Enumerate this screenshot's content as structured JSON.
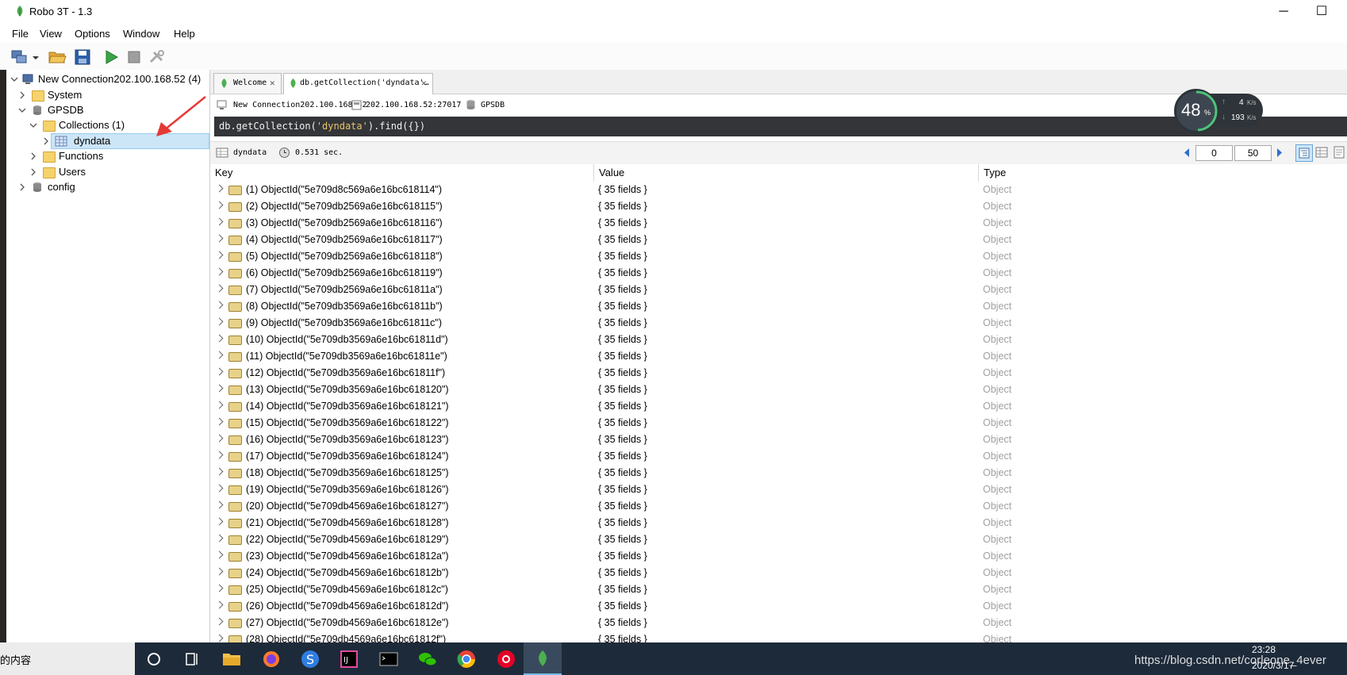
{
  "window": {
    "title": "Robo 3T - 1.3",
    "minimize": "─",
    "maximize": "☐"
  },
  "menu": [
    "File",
    "View",
    "Options",
    "Window",
    "Help"
  ],
  "tree": {
    "connection": "New Connection202.100.168.52 (4)",
    "system": "System",
    "db": "GPSDB",
    "collections": "Collections (1)",
    "collection_item": "dyndata",
    "functions": "Functions",
    "users": "Users",
    "config": "config"
  },
  "tabs": [
    {
      "label": "Welcome"
    },
    {
      "label": "db.getCollection('dyndata'…"
    }
  ],
  "info": {
    "connection": "New Connection202.100.168.52",
    "host": "202.100.168.52:27017",
    "db": "GPSDB"
  },
  "query": {
    "prefix": "db.getCollection(",
    "arg": "'dyndata'",
    "suffix": ").find({})"
  },
  "results": {
    "collection": "dyndata",
    "time": "0.531 sec.",
    "skip": "0",
    "limit": "50"
  },
  "table": {
    "headers": [
      "Key",
      "Value",
      "Type"
    ],
    "value": "{ 35 fields }",
    "type": "Object",
    "keys": [
      "(1) ObjectId(\"5e709d8c569a6e16bc618114\")",
      "(2) ObjectId(\"5e709db2569a6e16bc618115\")",
      "(3) ObjectId(\"5e709db2569a6e16bc618116\")",
      "(4) ObjectId(\"5e709db2569a6e16bc618117\")",
      "(5) ObjectId(\"5e709db2569a6e16bc618118\")",
      "(6) ObjectId(\"5e709db2569a6e16bc618119\")",
      "(7) ObjectId(\"5e709db2569a6e16bc61811a\")",
      "(8) ObjectId(\"5e709db3569a6e16bc61811b\")",
      "(9) ObjectId(\"5e709db3569a6e16bc61811c\")",
      "(10) ObjectId(\"5e709db3569a6e16bc61811d\")",
      "(11) ObjectId(\"5e709db3569a6e16bc61811e\")",
      "(12) ObjectId(\"5e709db3569a6e16bc61811f\")",
      "(13) ObjectId(\"5e709db3569a6e16bc618120\")",
      "(14) ObjectId(\"5e709db3569a6e16bc618121\")",
      "(15) ObjectId(\"5e709db3569a6e16bc618122\")",
      "(16) ObjectId(\"5e709db3569a6e16bc618123\")",
      "(17) ObjectId(\"5e709db3569a6e16bc618124\")",
      "(18) ObjectId(\"5e709db3569a6e16bc618125\")",
      "(19) ObjectId(\"5e709db3569a6e16bc618126\")",
      "(20) ObjectId(\"5e709db4569a6e16bc618127\")",
      "(21) ObjectId(\"5e709db4569a6e16bc618128\")",
      "(22) ObjectId(\"5e709db4569a6e16bc618129\")",
      "(23) ObjectId(\"5e709db4569a6e16bc61812a\")",
      "(24) ObjectId(\"5e709db4569a6e16bc61812b\")",
      "(25) ObjectId(\"5e709db4569a6e16bc61812c\")",
      "(26) ObjectId(\"5e709db4569a6e16bc61812d\")",
      "(27) ObjectId(\"5e709db4569a6e16bc61812e\")",
      "(28) ObjectId(\"5e709db4569a6e16bc61812f\")"
    ]
  },
  "speed_widget": {
    "percent": "48",
    "percent_unit": "%",
    "up": "4",
    "up_unit": "K/s",
    "down": "193",
    "down_unit": "K/s"
  },
  "taskbar": {
    "search_text": "的内容",
    "time": "23:28",
    "date": "2020/3/17",
    "watermark": "https://blog.csdn.net/corleone_4ever"
  },
  "colors": {
    "accent_green": "#4caf50",
    "selection": "#cce5f7",
    "query_bg": "#333538",
    "taskbar_bg": "#1d2a3a"
  }
}
